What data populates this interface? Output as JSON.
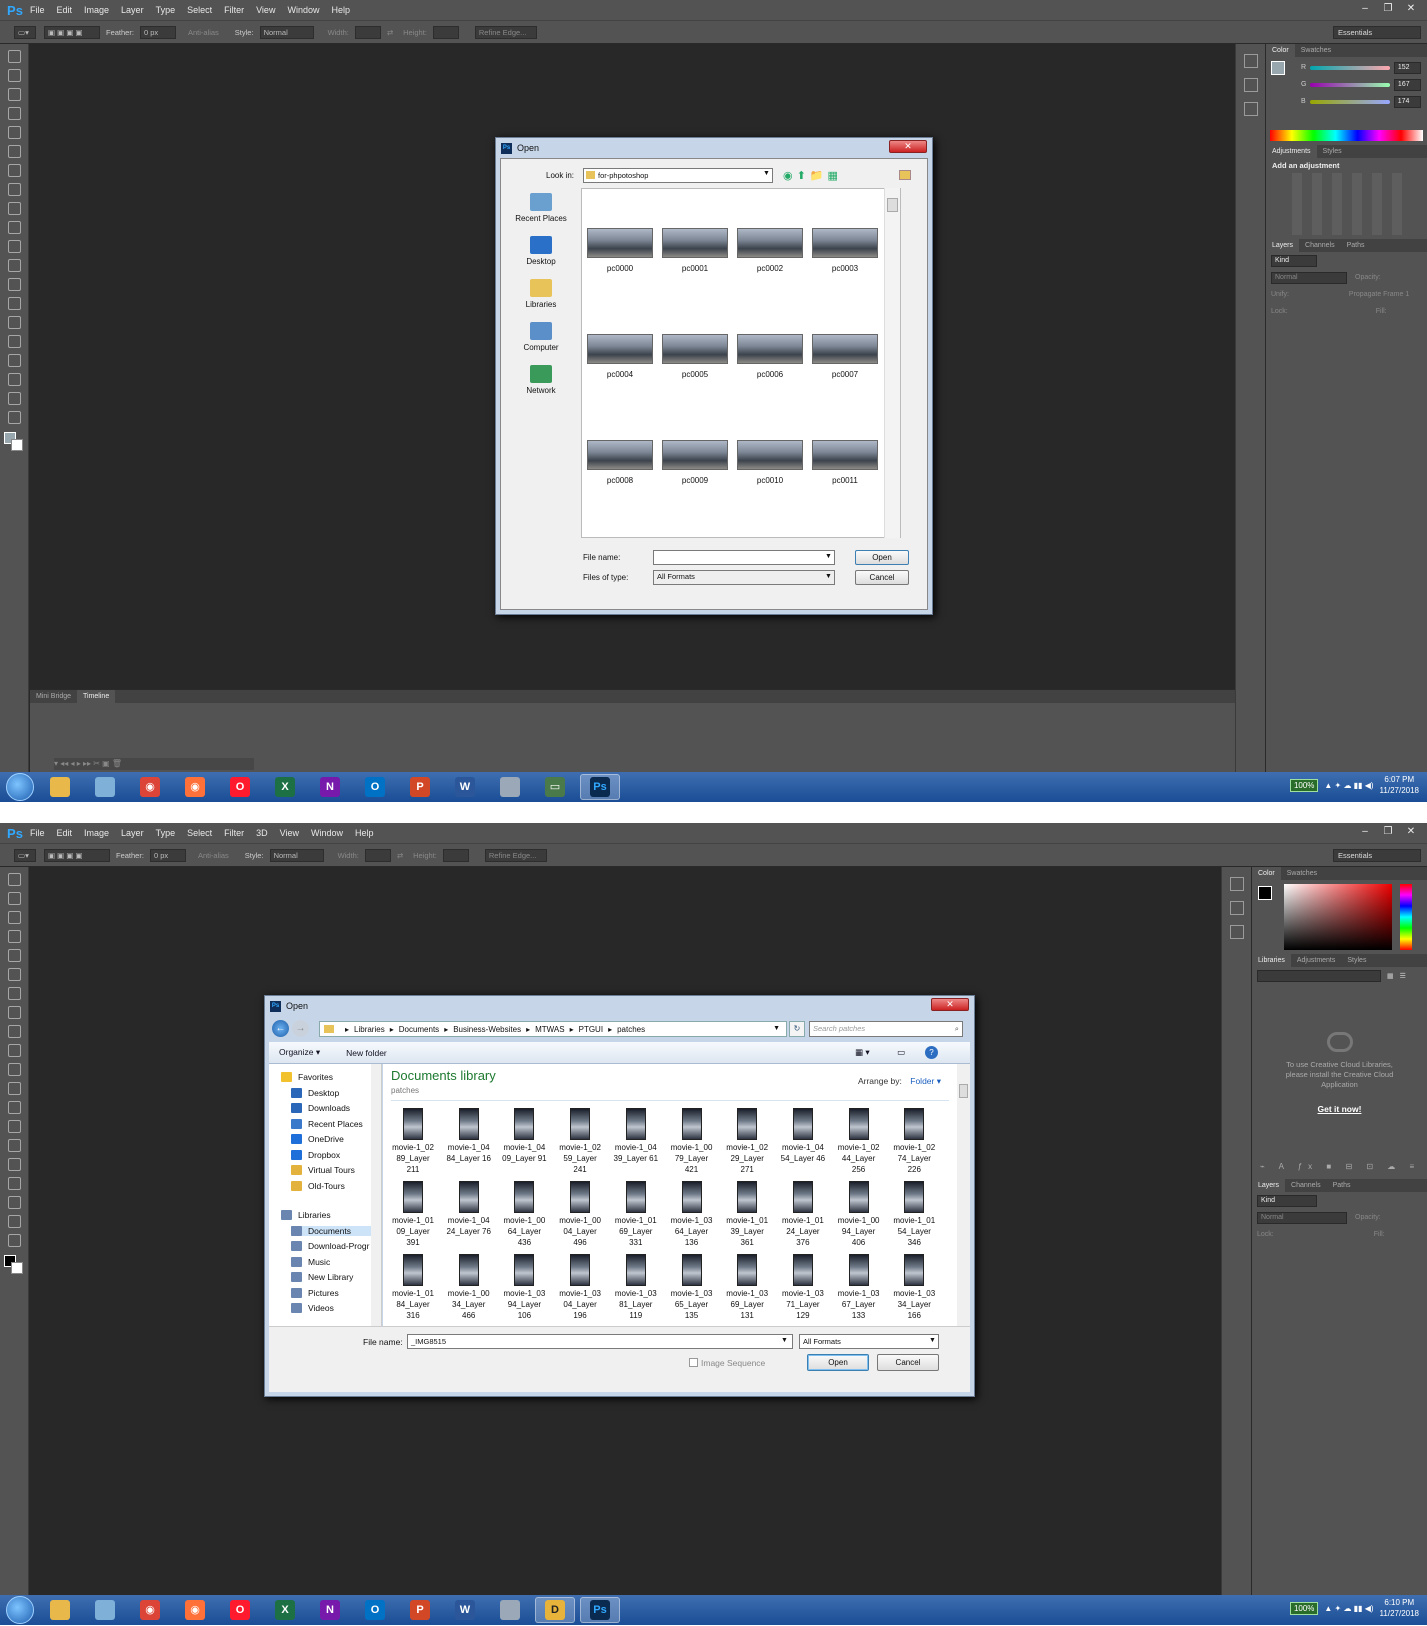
{
  "app": {
    "logo": "Ps",
    "menu1": [
      "File",
      "Edit",
      "Image",
      "Layer",
      "Type",
      "Select",
      "Filter",
      "View",
      "Window",
      "Help"
    ],
    "menu2": [
      "File",
      "Edit",
      "Image",
      "Layer",
      "Type",
      "Select",
      "Filter",
      "3D",
      "View",
      "Window",
      "Help"
    ]
  },
  "options": {
    "feather_label": "Feather:",
    "feather_value": "0 px",
    "antialias": "Anti-alias",
    "style_label": "Style:",
    "style_value": "Normal",
    "width_label": "Width:",
    "height_label": "Height:",
    "refine": "Refine Edge...",
    "workspace": "Essentials"
  },
  "panels1": {
    "color_tabs": [
      "Color",
      "Swatches"
    ],
    "r_label": "R",
    "g_label": "G",
    "b_label": "B",
    "r": "152",
    "g": "167",
    "b": "174",
    "adj_tabs": [
      "Adjustments",
      "Styles"
    ],
    "adj_title": "Add an adjustment",
    "layer_tabs": [
      "Layers",
      "Channels",
      "Paths"
    ],
    "kind": "Kind",
    "blend": "Normal",
    "opacity": "Opacity:",
    "unify": "Unify:",
    "propagate": "Propagate Frame 1",
    "lock": "Lock:",
    "fill": "Fill:"
  },
  "panels2": {
    "color_tabs": [
      "Color",
      "Swatches"
    ],
    "lib_tabs": [
      "Libraries",
      "Adjustments",
      "Styles"
    ],
    "cc_msg": "To use Creative Cloud Libraries, please install the Creative Cloud Application",
    "cc_link": "Get it now!",
    "layer_tabs": [
      "Layers",
      "Channels",
      "Paths"
    ],
    "kind": "Kind",
    "blend": "Normal",
    "opacity": "Opacity:",
    "lock": "Lock:",
    "fill": "Fill:"
  },
  "timeline": {
    "tabs": [
      "Mini Bridge",
      "Timeline"
    ]
  },
  "dialog1": {
    "title": "Open",
    "look_in_label": "Look in:",
    "look_in": "for-phpotoshop",
    "places": [
      "Recent Places",
      "Desktop",
      "Libraries",
      "Computer",
      "Network"
    ],
    "files": [
      "pc0000",
      "pc0001",
      "pc0002",
      "pc0003",
      "pc0004",
      "pc0005",
      "pc0006",
      "pc0007",
      "pc0008",
      "pc0009",
      "pc0010",
      "pc0011"
    ],
    "filename_label": "File name:",
    "filename": "",
    "type_label": "Files of type:",
    "type": "All Formats",
    "open": "Open",
    "cancel": "Cancel"
  },
  "dialog2": {
    "title": "Open",
    "breadcrumb": [
      "Libraries",
      "Documents",
      "Business-Websites",
      "MTWAS",
      "PTGUI",
      "patches"
    ],
    "search_placeholder": "Search patches",
    "organize": "Organize ▾",
    "new_folder": "New folder",
    "lib_title": "Documents library",
    "lib_sub": "patches",
    "arrange_label": "Arrange by:",
    "arrange_value": "Folder ▾",
    "nav": [
      "Favorites",
      "Desktop",
      "Downloads",
      "Recent Places",
      "OneDrive",
      "Dropbox",
      "Virtual Tours",
      "Old-Tours",
      "Libraries",
      "Documents",
      "Download-Progr",
      "Music",
      "New Library",
      "Pictures",
      "Videos"
    ],
    "files": [
      [
        "movie-1_02",
        "89_Layer",
        "211"
      ],
      [
        "movie-1_04",
        "84_Layer 16",
        ""
      ],
      [
        "movie-1_04",
        "09_Layer 91",
        ""
      ],
      [
        "movie-1_02",
        "59_Layer",
        "241"
      ],
      [
        "movie-1_04",
        "39_Layer 61",
        ""
      ],
      [
        "movie-1_00",
        "79_Layer",
        "421"
      ],
      [
        "movie-1_02",
        "29_Layer",
        "271"
      ],
      [
        "movie-1_04",
        "54_Layer 46",
        ""
      ],
      [
        "movie-1_02",
        "44_Layer",
        "256"
      ],
      [
        "movie-1_02",
        "74_Layer",
        "226"
      ],
      [
        "movie-1_01",
        "09_Layer",
        "391"
      ],
      [
        "movie-1_04",
        "24_Layer 76",
        ""
      ],
      [
        "movie-1_00",
        "64_Layer",
        "436"
      ],
      [
        "movie-1_00",
        "04_Layer",
        "496"
      ],
      [
        "movie-1_01",
        "69_Layer",
        "331"
      ],
      [
        "movie-1_03",
        "64_Layer",
        "136"
      ],
      [
        "movie-1_01",
        "39_Layer",
        "361"
      ],
      [
        "movie-1_01",
        "24_Layer",
        "376"
      ],
      [
        "movie-1_00",
        "94_Layer",
        "406"
      ],
      [
        "movie-1_01",
        "54_Layer",
        "346"
      ],
      [
        "movie-1_01",
        "84_Layer",
        "316"
      ],
      [
        "movie-1_00",
        "34_Layer",
        "466"
      ],
      [
        "movie-1_03",
        "94_Layer",
        "106"
      ],
      [
        "movie-1_03",
        "04_Layer",
        "196"
      ],
      [
        "movie-1_03",
        "81_Layer",
        "119"
      ],
      [
        "movie-1_03",
        "65_Layer",
        "135"
      ],
      [
        "movie-1_03",
        "69_Layer",
        "131"
      ],
      [
        "movie-1_03",
        "71_Layer",
        "129"
      ],
      [
        "movie-1_03",
        "67_Layer",
        "133"
      ],
      [
        "movie-1_03",
        "34_Layer",
        "166"
      ]
    ],
    "filename_label": "File name:",
    "filename": "_IMG8515",
    "type": "All Formats",
    "image_sequence": "Image Sequence",
    "open": "Open",
    "cancel": "Cancel"
  },
  "taskbar1": {
    "battery": "100%",
    "time": "6:07 PM",
    "date": "11/27/2018"
  },
  "taskbar2": {
    "battery": "100%",
    "time": "6:10 PM",
    "date": "11/27/2018"
  },
  "taskbar_apps": [
    {
      "icon": "explorer-icon",
      "color": "#e8b84a",
      "glyph": ""
    },
    {
      "icon": "window-icon",
      "color": "#7fb0d8",
      "glyph": ""
    },
    {
      "icon": "chrome-icon",
      "color": "#db4437",
      "glyph": "◉"
    },
    {
      "icon": "firefox-icon",
      "color": "#ff7139",
      "glyph": "◉"
    },
    {
      "icon": "opera-icon",
      "color": "#ff1b2d",
      "glyph": "O"
    },
    {
      "icon": "excel-icon",
      "color": "#1d7044",
      "glyph": "X"
    },
    {
      "icon": "onenote-icon",
      "color": "#7719aa",
      "glyph": "N"
    },
    {
      "icon": "outlook-icon",
      "color": "#0072c6",
      "glyph": "O"
    },
    {
      "icon": "powerpoint-icon",
      "color": "#d24726",
      "glyph": "P"
    },
    {
      "icon": "word-icon",
      "color": "#2b579a",
      "glyph": "W"
    },
    {
      "icon": "calculator-icon",
      "color": "#9aa8b8",
      "glyph": ""
    }
  ]
}
